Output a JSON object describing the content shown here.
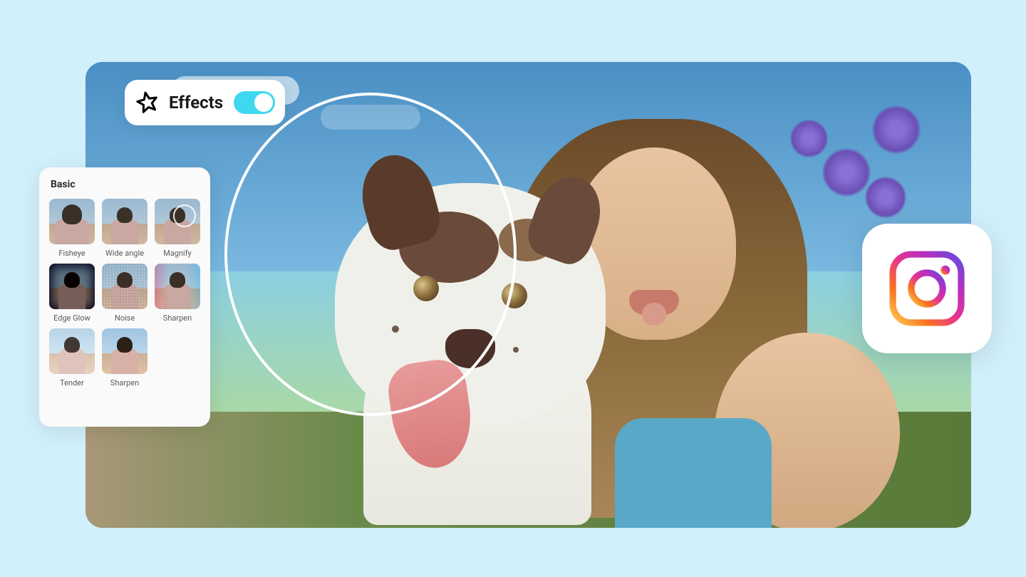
{
  "effects_toggle": {
    "label": "Effects",
    "icon": "star-icon",
    "enabled": true
  },
  "effects_panel": {
    "heading": "Basic",
    "items": [
      {
        "label": "Fisheye",
        "variant": "fisheye"
      },
      {
        "label": "Wide angle",
        "variant": "wide"
      },
      {
        "label": "Magnify",
        "variant": "magnify"
      },
      {
        "label": "Edge Glow",
        "variant": "edgeglow"
      },
      {
        "label": "Noise",
        "variant": "noise"
      },
      {
        "label": "Sharpen",
        "variant": "sharpen"
      },
      {
        "label": "Tender",
        "variant": "tender"
      },
      {
        "label": "Sharpen",
        "variant": "sharpen2"
      }
    ]
  },
  "social_badge": {
    "platform": "instagram"
  },
  "colors": {
    "page_bg": "#d1f0fc",
    "toggle_accent": "#3fd8f0",
    "panel_bg": "#fafafa"
  }
}
